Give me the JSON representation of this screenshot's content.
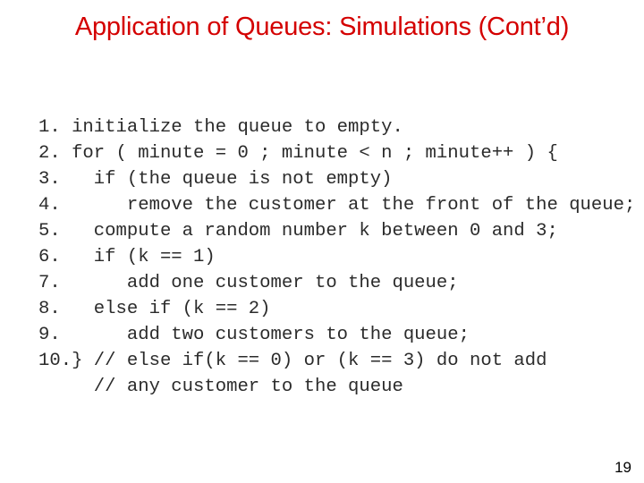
{
  "slide": {
    "title": "Application of Queues: Simulations (Cont’d)",
    "page_number": "19"
  },
  "code_lines": [
    "1. initialize the queue to empty.",
    "2. for ( minute = 0 ; minute < n ; minute++ ) {",
    "3.   if (the queue is not empty)",
    "4.      remove the customer at the front of the queue;",
    "5.   compute a random number k between 0 and 3;",
    "6.   if (k == 1)",
    "7.      add one customer to the queue;",
    "8.   else if (k == 2)",
    "9.      add two customers to the queue;",
    "10.} // else if(k == 0) or (k == 3) do not add",
    "     // any customer to the queue"
  ],
  "colors": {
    "title": "#d40000",
    "code": "#2b2b2b",
    "page_number": "#000000"
  }
}
